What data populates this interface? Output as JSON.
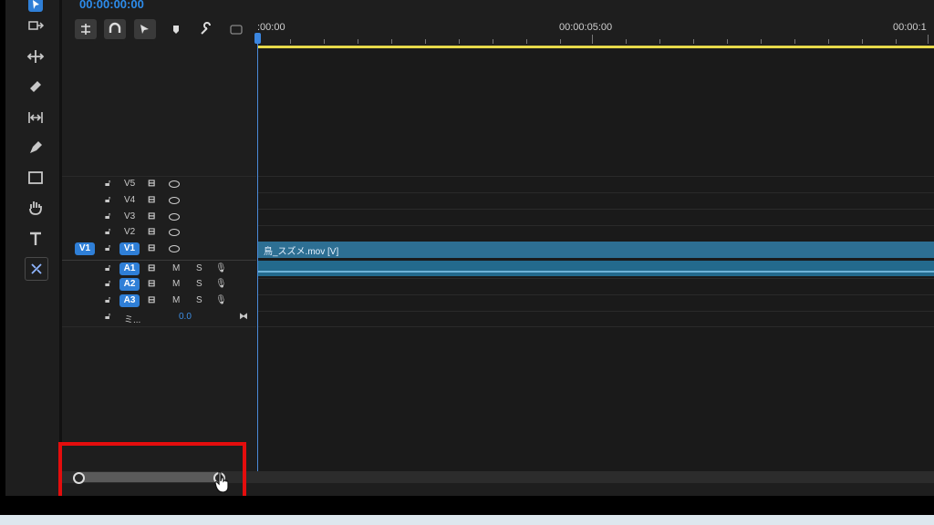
{
  "sequence": {
    "timecode": "00:00:00:00"
  },
  "ruler": {
    "timecodes": [
      ":00:00",
      "00:00:05:00",
      "00:00:1"
    ]
  },
  "toolbar": {
    "tools": [
      "selection-tool-icon",
      "track-select-icon",
      "ripple-edit-icon",
      "razor-icon",
      "slip-icon",
      "pen-icon",
      "rectangle-icon",
      "hand-icon",
      "type-icon",
      "remix-icon"
    ]
  },
  "video_tracks": [
    {
      "name": "V5"
    },
    {
      "name": "V4"
    },
    {
      "name": "V3"
    },
    {
      "name": "V2"
    },
    {
      "name": "V1",
      "source_patch": "V1"
    }
  ],
  "audio_tracks": [
    {
      "name": "A1",
      "m": "M",
      "s": "S"
    },
    {
      "name": "A2",
      "m": "M",
      "s": "S"
    },
    {
      "name": "A3",
      "m": "M",
      "s": "S"
    }
  ],
  "mix_track": {
    "name": "ミ...",
    "value": "0.0"
  },
  "clip": {
    "label": "鳥_スズメ.mov [V]"
  },
  "colors": {
    "accent": "#2f7fd7",
    "work_area": "#e6d94a",
    "clip_video": "#2d6f93",
    "highlight": "#e40d0d"
  }
}
